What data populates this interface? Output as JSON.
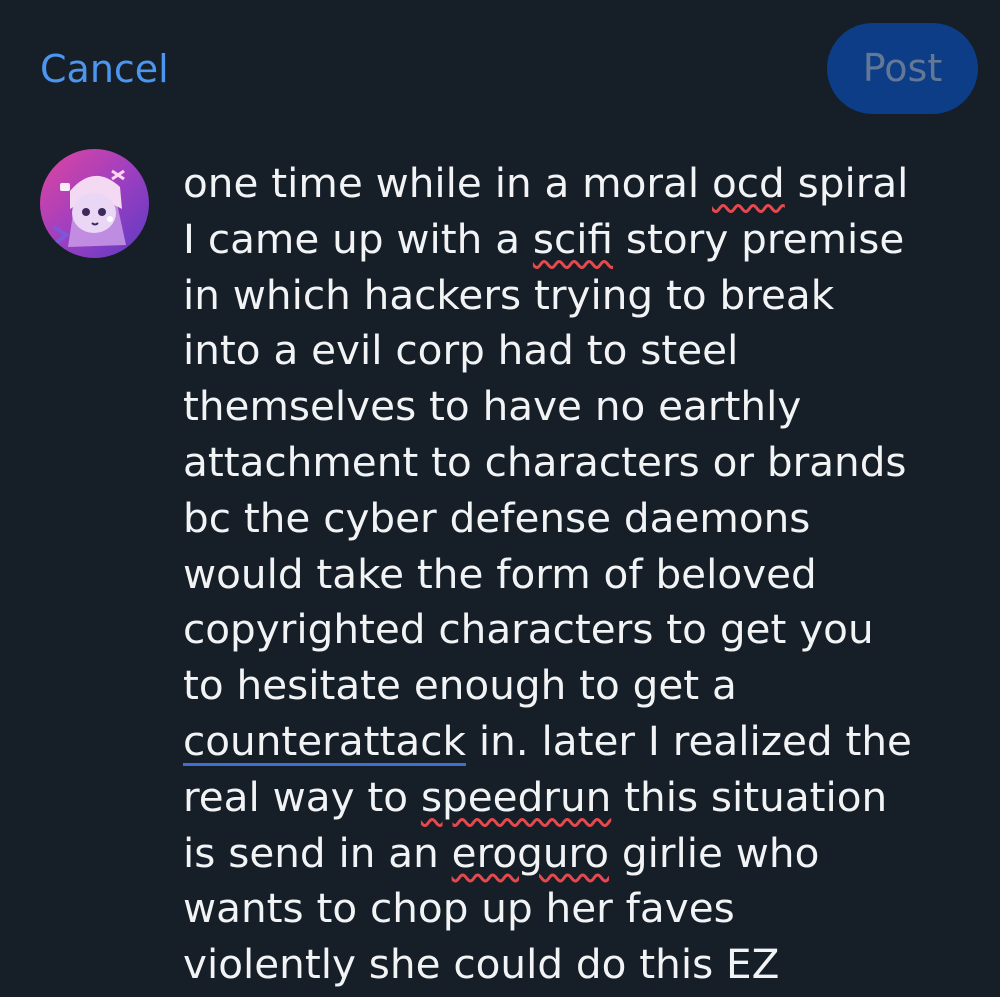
{
  "header": {
    "cancel_label": "Cancel",
    "post_label": "Post"
  },
  "composer": {
    "avatar_icon": "user-avatar-illustration",
    "colors": {
      "background": "#161e27",
      "cancel": "#4d96f0",
      "post_button_bg": "#0c3d86",
      "post_button_text": "#637896",
      "text": "#f1f3f5",
      "spellcheck_underline": "#e5484d",
      "link_underline": "#3f6fd0"
    },
    "lines": [
      [
        "one time while in a moral ",
        "ocd",
        " spiral"
      ],
      [
        "I came up with a ",
        "scifi",
        " story premise"
      ],
      [
        "in which hackers trying to break"
      ],
      [
        "into a evil corp had to steel"
      ],
      [
        "themselves to have no earthly"
      ],
      [
        "attachment to characters or brands"
      ],
      [
        "bc the cyber defense daemons"
      ],
      [
        "would take the form of beloved"
      ],
      [
        "copyrighted characters to get you"
      ],
      [
        "to hesitate enough to get a"
      ],
      [
        "counterattack",
        " in. later I realized the"
      ],
      [
        "real way to ",
        "speedrun",
        " this situation"
      ],
      [
        "is send in an ",
        "eroguro",
        " girlie who"
      ],
      [
        "wants to chop up her faves"
      ],
      [
        "violently she could do this EZ"
      ]
    ]
  }
}
